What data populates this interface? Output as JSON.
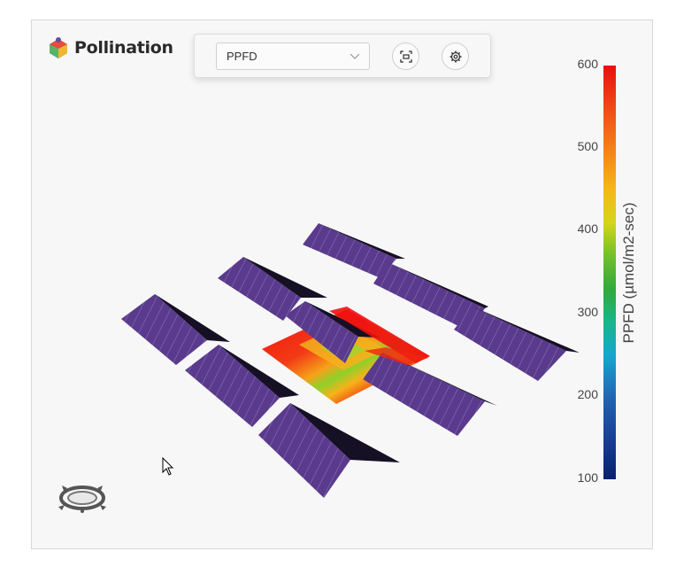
{
  "app": {
    "logo_text": "Pollination",
    "logo_icon": "pollination-logo-icon"
  },
  "toolbar": {
    "metric_select": {
      "value": "PPFD",
      "icon": "chevron-down-icon"
    },
    "fit_view_button": {
      "icon": "fit-view-icon"
    },
    "settings_button": {
      "icon": "gear-icon"
    }
  },
  "legend": {
    "title": "PPFD (µmol/m2-sec)",
    "ticks": [
      "600",
      "500",
      "400",
      "300",
      "200",
      "100"
    ],
    "range": [
      100,
      600
    ],
    "colors": [
      "#09206e",
      "#1f66b4",
      "#16a6cf",
      "#2faa3a",
      "#d4d51c",
      "#f3801b",
      "#e8100f"
    ]
  },
  "viewport": {
    "panel_color": "#5b3b8c",
    "compass_icon": "view-compass-icon"
  }
}
